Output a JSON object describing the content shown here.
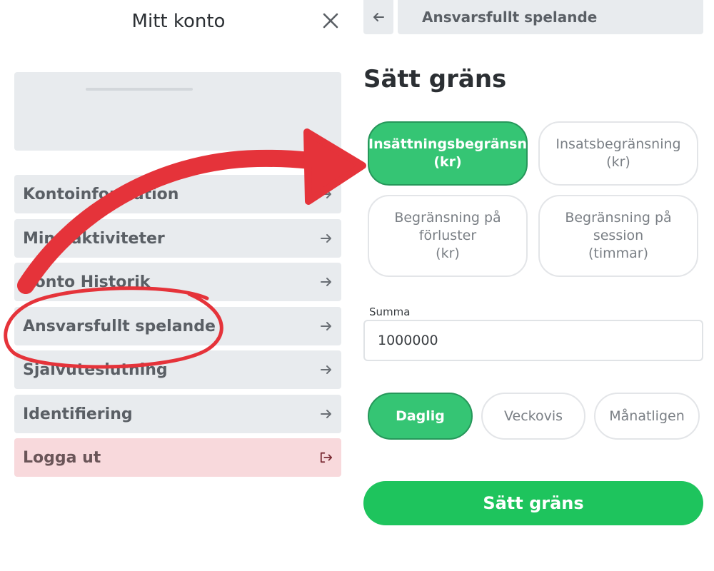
{
  "left_panel": {
    "title": "Mitt konto",
    "close_icon": "close-icon",
    "menu": [
      {
        "label": "Kontoinformation",
        "icon": "arrow-right-icon"
      },
      {
        "label": "Mina aktiviteter",
        "icon": "arrow-right-icon"
      },
      {
        "label": "Konto Historik",
        "icon": "arrow-right-icon"
      },
      {
        "label": "Ansvarsfullt spelande",
        "icon": "arrow-right-icon"
      },
      {
        "label": "Självuteslutning",
        "icon": "arrow-right-icon"
      },
      {
        "label": "Identifiering",
        "icon": "arrow-right-icon"
      },
      {
        "label": "Logga ut",
        "icon": "logout-icon"
      }
    ]
  },
  "right_panel": {
    "header_title": "Ansvarsfullt spelande",
    "back_icon": "arrow-left-icon",
    "page_title": "Sätt gräns",
    "limit_types": [
      {
        "line1": "Insättningsbegränsn",
        "line2": "(kr)",
        "line3": "",
        "active": true
      },
      {
        "line1": "Insatsbegränsning",
        "line2": "(kr)",
        "line3": "",
        "active": false
      },
      {
        "line1": "Begränsning på",
        "line2": "förluster",
        "line3": "(kr)",
        "active": false
      },
      {
        "line1": "Begränsning på",
        "line2": "session",
        "line3": "(timmar)",
        "active": false
      }
    ],
    "amount_label": "Summa",
    "amount_value": "1000000",
    "periods": [
      {
        "label": "Daglig",
        "active": true
      },
      {
        "label": "Veckovis",
        "active": false
      },
      {
        "label": "Månatligen",
        "active": false
      }
    ],
    "submit_label": "Sätt gräns"
  },
  "colors": {
    "accent_green": "#35c574",
    "submit_green": "#1ec45d",
    "annotation_red": "#e5333a",
    "menu_bg": "#e8ebee",
    "logout_bg": "#f8d9dc"
  }
}
